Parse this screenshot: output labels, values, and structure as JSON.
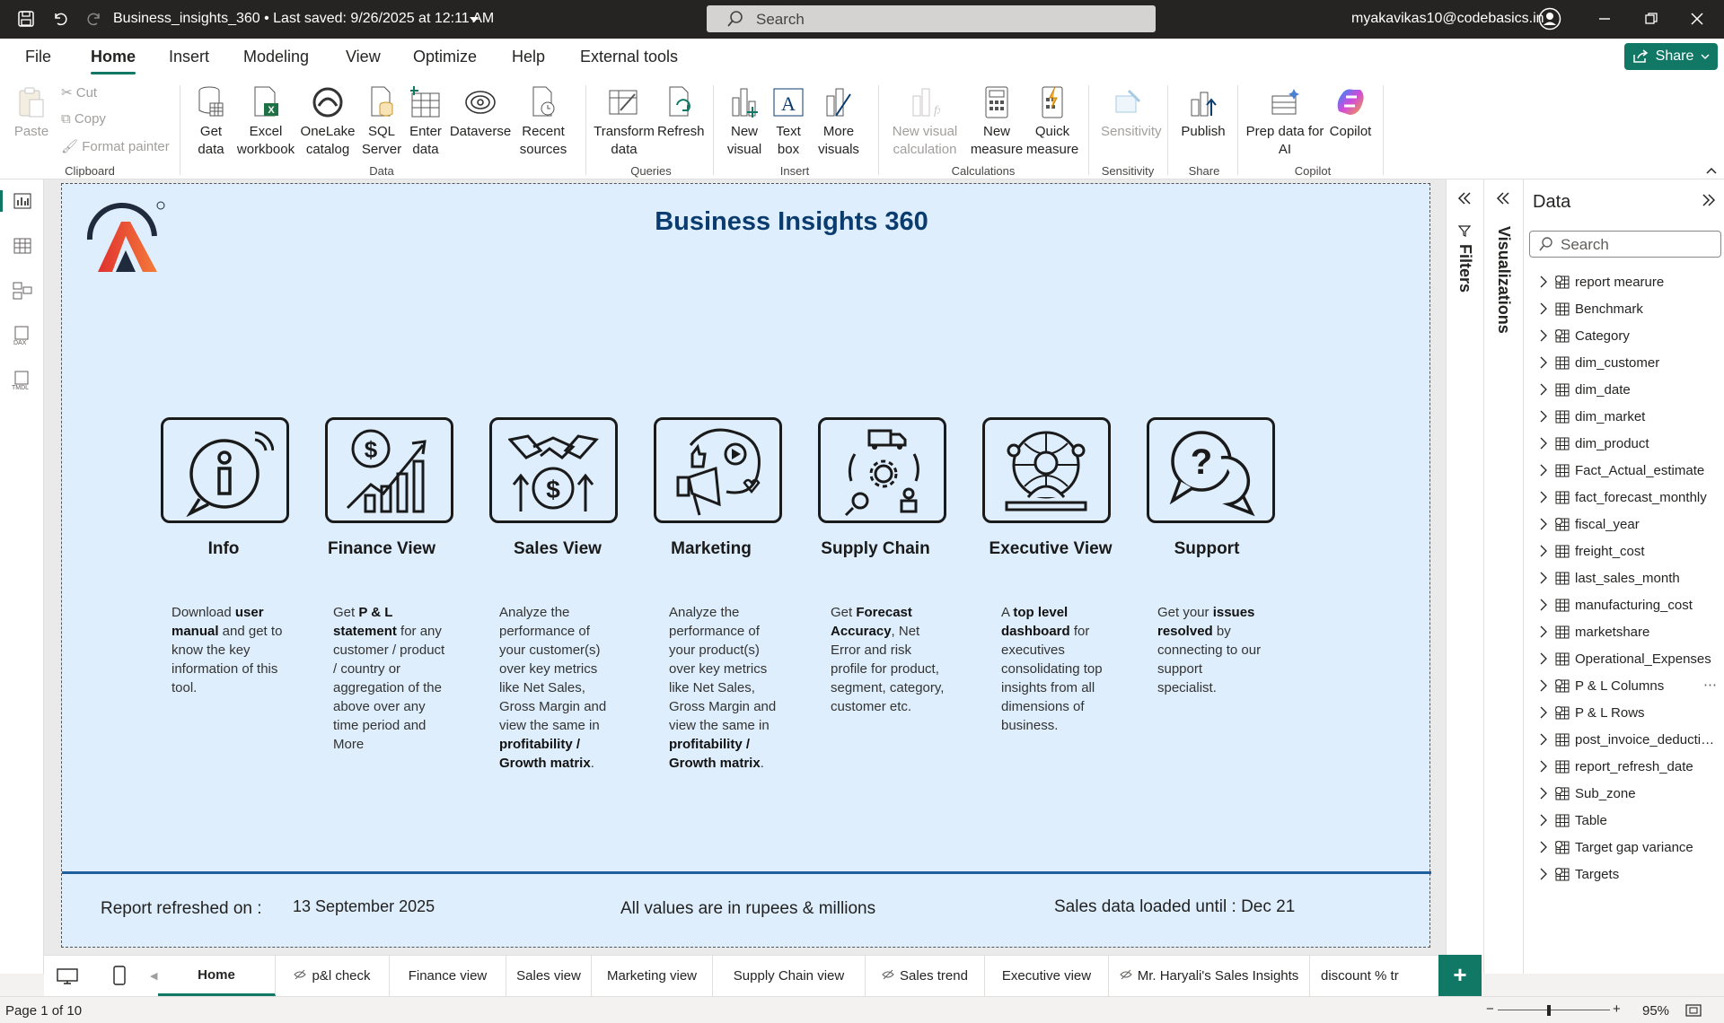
{
  "titlebar": {
    "file_title": "Business_insights_360  •  Last saved: 9/26/2025 at 12:11 AM",
    "search_placeholder": "Search",
    "user_email": "myakavikas10@codebasics.in"
  },
  "ribbon_tabs": [
    "File",
    "Home",
    "Insert",
    "Modeling",
    "View",
    "Optimize",
    "Help",
    "External tools"
  ],
  "share_label": "Share",
  "ribbon": {
    "clipboard": {
      "paste": "Paste",
      "cut": "Cut",
      "copy": "Copy",
      "format_painter": "Format painter",
      "group": "Clipboard"
    },
    "data": {
      "get_data": "Get data",
      "excel": "Excel workbook",
      "onelake": "OneLake catalog",
      "sql": "SQL Server",
      "enter": "Enter data",
      "dataverse": "Dataverse",
      "recent": "Recent sources",
      "group": "Data"
    },
    "queries": {
      "transform": "Transform data",
      "refresh": "Refresh",
      "group": "Queries"
    },
    "insert": {
      "new_visual": "New visual",
      "text_box": "Text box",
      "more_visuals": "More visuals",
      "group": "Insert"
    },
    "calculations": {
      "new_visual_calc": "New visual calculation",
      "new_measure": "New measure",
      "quick_measure": "Quick measure",
      "group": "Calculations"
    },
    "sensitivity": {
      "sensitivity": "Sensitivity",
      "group": "Sensitivity"
    },
    "share": {
      "publish": "Publish",
      "group": "Share"
    },
    "copilot": {
      "prep_data": "Prep data for AI",
      "copilot": "Copilot",
      "group": "Copilot"
    }
  },
  "report": {
    "title": "Business Insights 360",
    "cards": [
      {
        "title": "Info",
        "desc_html": "Download <b>user manual</b> and get to know the key information of this tool."
      },
      {
        "title": "Finance View",
        "desc_html": "Get  <b>P &amp; L statement</b> for any customer / product / country or aggregation of the above over any time period and More"
      },
      {
        "title": "Sales View",
        "desc_html": "Analyze the performance of your customer(s) over key metrics like Net Sales, Gross Margin and view the same in <b>profitability / Growth matrix</b>."
      },
      {
        "title": "Marketing",
        "desc_html": "Analyze the performance of your product(s) over key metrics like Net Sales, Gross Margin and view the same in <b>profitability / Growth matrix</b>."
      },
      {
        "title": "Supply Chain",
        "desc_html": "Get <b>Forecast Accuracy</b>, Net Error and risk profile for product, segment, category, customer etc."
      },
      {
        "title": "Executive View",
        "desc_html": "A <b>top level dashboard</b> for executives consolidating top insights from all dimensions of business."
      },
      {
        "title": "Support",
        "desc_html": "Get your <b>issues resolved</b> by connecting to our support specialist."
      }
    ],
    "footer": {
      "refreshed_label": "Report refreshed on :",
      "refreshed_value": "13 September 2025",
      "values_note": "All values are in rupees & millions",
      "sales_loaded": "Sales data loaded until : Dec 21"
    }
  },
  "panes": {
    "filters": "Filters",
    "visualizations": "Visualizations"
  },
  "data_pane": {
    "title": "Data",
    "search_placeholder": "Search",
    "items": [
      "report mearure",
      "Benchmark",
      "Category",
      "dim_customer",
      "dim_date",
      "dim_market",
      "dim_product",
      "Fact_Actual_estimate",
      "fact_forecast_monthly",
      "fiscal_year",
      "freight_cost",
      "last_sales_month",
      "manufacturing_cost",
      "marketshare",
      "Operational_Expenses",
      "P & L Columns",
      "P & L Rows",
      "post_invoice_deductions",
      "report_refresh_date",
      "Sub_zone",
      "Table",
      "Target gap variance",
      "Targets"
    ]
  },
  "page_tabs": [
    "Home",
    "p&l check",
    "Finance view",
    "Sales view",
    "Marketing view",
    "Supply Chain view",
    "Sales trend",
    "Executive view",
    "Mr. Haryali's Sales Insights",
    "discount % tr"
  ],
  "status": {
    "page": "Page 1 of 10",
    "zoom": "95%"
  },
  "colors": {
    "accent": "#117865",
    "canvas_bg": "#deeefc",
    "title_blue": "#0b3c6f"
  }
}
